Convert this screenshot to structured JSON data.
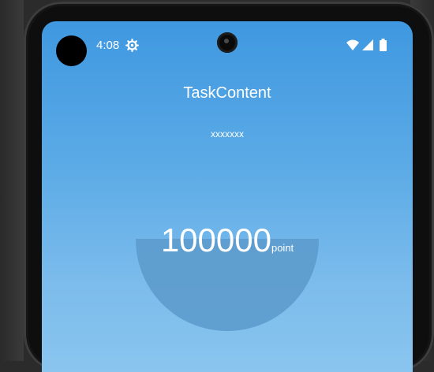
{
  "status_bar": {
    "time": "4:08",
    "icons": [
      "gear-icon",
      "wifi-icon",
      "signal-icon",
      "battery-icon"
    ]
  },
  "content": {
    "title": "TaskContent",
    "subtitle": "xxxxxxx",
    "points_value": "100000",
    "points_unit": "point"
  },
  "colors": {
    "gradient_top": "#3f98e0",
    "gradient_bottom": "#89c5ee",
    "half_circle": "#5a9acb",
    "text": "#ffffff"
  }
}
